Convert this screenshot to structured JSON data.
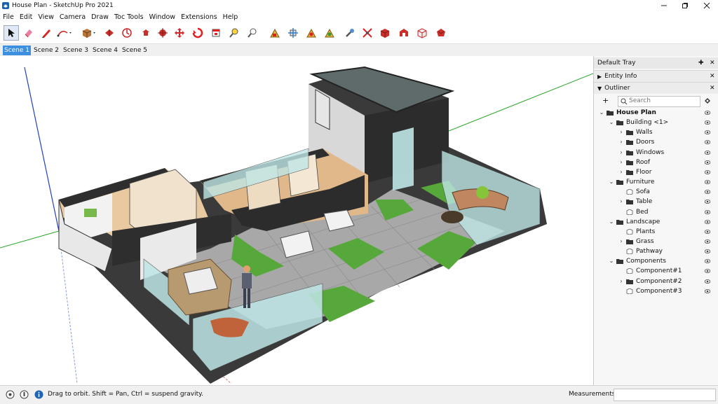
{
  "window": {
    "title": "House Plan - SketchUp Pro 2021",
    "controls": [
      "minimize",
      "restore",
      "close"
    ]
  },
  "menu": [
    "File",
    "Edit",
    "View",
    "Camera",
    "Draw",
    "Toc Tools",
    "Window",
    "Extensions",
    "Help"
  ],
  "toolbar": {
    "tools": [
      "select-icon",
      "eraser-icon",
      "pencil-icon",
      "arc-icon",
      "push-pull-icon",
      "follow-me-icon",
      "move-icon",
      "rotate-icon",
      "scale-icon",
      "offset-icon",
      "paint-bucket-icon",
      "tape-measure-icon",
      "zoom-icon",
      "orbit-icon",
      "pan-icon",
      "zoom-window-icon",
      "zoom-extents-icon",
      "walk-icon",
      "position-camera-icon",
      "section-plane-icon",
      "component-icon",
      "warehouse-icon",
      "extension-icon",
      "ruby-icon"
    ]
  },
  "scenes": [
    "Scene 1",
    "Scene 2",
    "Scene 3",
    "Scene 4",
    "Scene 5"
  ],
  "active_scene": "Scene 1",
  "tray": {
    "title": "Default Tray",
    "entity_info": "Entity Info",
    "outliner": "Outliner",
    "search_placeholder": "Search",
    "tree": [
      {
        "label": "House Plan",
        "expanded": true,
        "bold": true
      },
      {
        "label": "Building <1>",
        "expanded": true
      },
      {
        "label": "Walls",
        "expanded": false
      },
      {
        "label": "Doors",
        "expanded": false
      },
      {
        "label": "Windows",
        "expanded": false
      },
      {
        "label": "Roof",
        "expanded": false
      },
      {
        "label": "Floor",
        "expanded": false
      },
      {
        "label": "Furniture",
        "expanded": true
      },
      {
        "label": "Sofa"
      },
      {
        "label": "Table",
        "expanded": false
      },
      {
        "label": "Bed"
      },
      {
        "label": "Landscape",
        "expanded": true
      },
      {
        "label": "Plants"
      },
      {
        "label": "Grass",
        "expanded": false
      },
      {
        "label": "Pathway"
      },
      {
        "label": "Components",
        "expanded": true
      },
      {
        "label": "Component#1"
      },
      {
        "label": "Component#2",
        "expanded": false
      },
      {
        "label": "Component#3"
      }
    ]
  },
  "status": {
    "hint": "Drag to orbit. Shift = Pan, Ctrl = suspend gravity.",
    "measurements_label": "Measurements",
    "measurements_value": ""
  },
  "colors": {
    "accent": "#3d8fe0",
    "axis_red": "#e02020",
    "axis_green": "#2aa52a",
    "axis_blue": "#2040c0",
    "grass": "#57a83a",
    "wall_dark": "#2e2e2e",
    "glass": "#bfe6e6"
  }
}
